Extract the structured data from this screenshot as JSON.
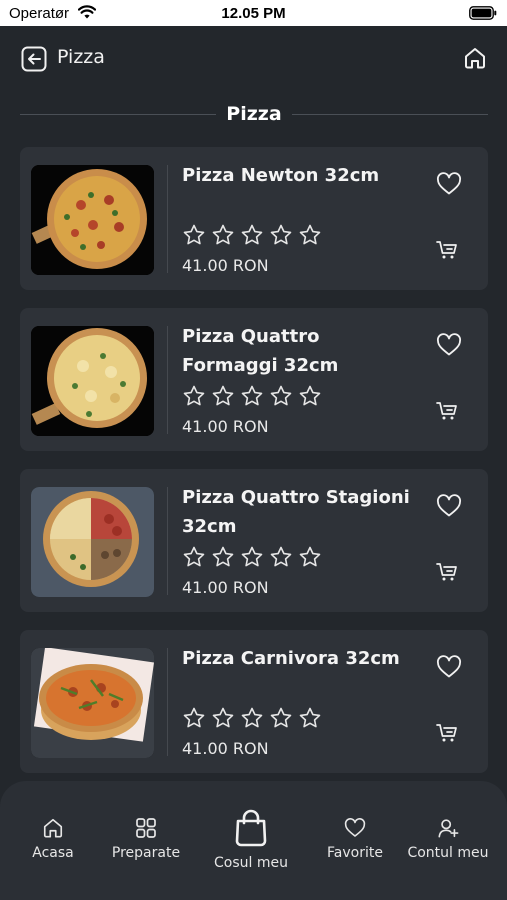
{
  "status_bar": {
    "carrier": "Operatør",
    "time": "12.05 PM"
  },
  "header": {
    "title": "Pizza",
    "back_icon": "back-arrow-icon",
    "home_icon": "home-icon"
  },
  "section": {
    "title": "Pizza"
  },
  "products": [
    {
      "name": "Pizza Newton 32cm",
      "rating": 0,
      "max_rating": 5,
      "price": "41.00 RON"
    },
    {
      "name": "Pizza Quattro Formaggi 32cm",
      "rating": 0,
      "max_rating": 5,
      "price": "41.00 RON"
    },
    {
      "name": "Pizza Quattro Stagioni 32cm",
      "rating": 0,
      "max_rating": 5,
      "price": "41.00 RON"
    },
    {
      "name": "Pizza Carnivora 32cm",
      "rating": 0,
      "max_rating": 5,
      "price": "41.00 RON"
    }
  ],
  "bottom_nav": {
    "items": [
      {
        "label": "Acasa",
        "icon": "home-icon"
      },
      {
        "label": "Preparate",
        "icon": "grid-icon"
      },
      {
        "label": "Cosul meu",
        "icon": "shopping-bag-icon"
      },
      {
        "label": "Favorite",
        "icon": "heart-icon"
      },
      {
        "label": "Contul meu",
        "icon": "user-add-icon"
      }
    ]
  },
  "colors": {
    "background": "#23272c",
    "card": "#2e3238",
    "nav": "#2b2f35",
    "text": "#ffffff"
  }
}
